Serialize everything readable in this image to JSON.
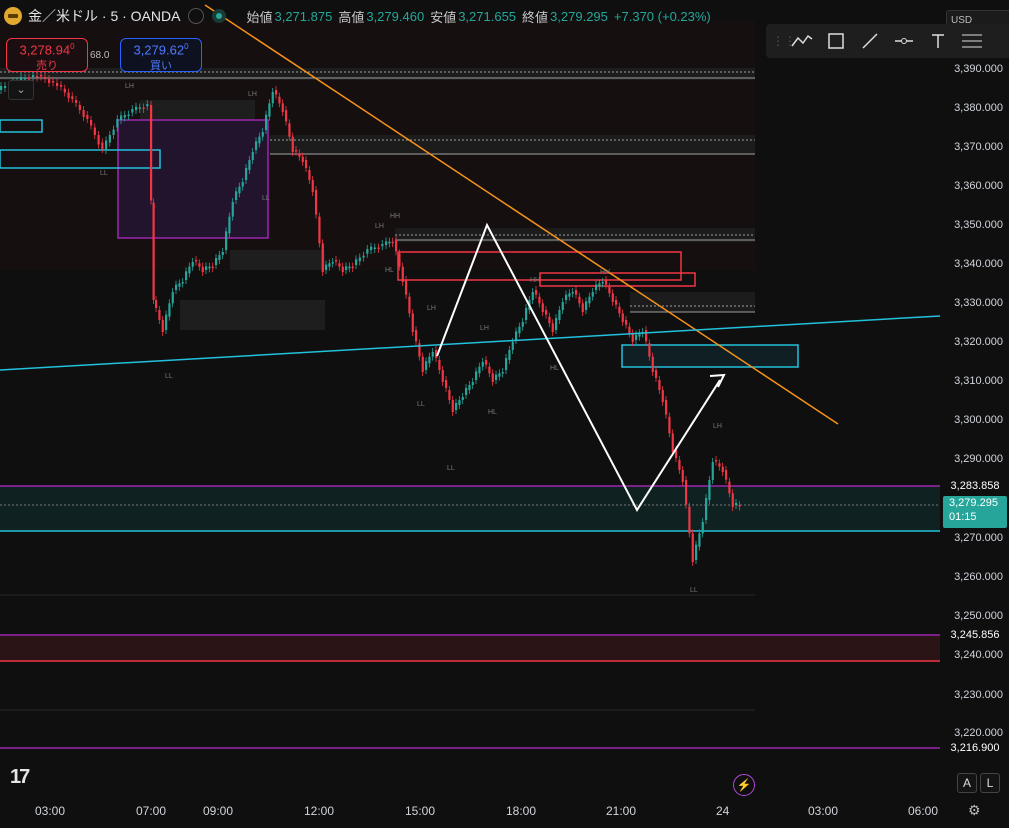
{
  "header": {
    "symbol": "金／米ドル · 5 · OANDA",
    "open_label": "始値",
    "open": "3,271.875",
    "high_label": "高値",
    "high": "3,279.460",
    "low_label": "安値",
    "low": "3,271.655",
    "close_label": "終値",
    "close": "3,279.295",
    "change": "+7.370 (+0.23%)"
  },
  "trade": {
    "sell_price": "3,278.94",
    "sell_price_sup": "0",
    "sell_label": "売り",
    "spread": "68.0",
    "buy_price": "3,279.62",
    "buy_price_sup": "0",
    "buy_label": "買い"
  },
  "toolbar": {
    "icons": [
      "pattern-icon",
      "rectangle-icon",
      "trendline-icon",
      "horizontal-ray-icon",
      "text-icon",
      "fib-icon"
    ]
  },
  "currency": "USD",
  "y_axis": {
    "labels": [
      "3,390.000",
      "3,380.000",
      "3,370.000",
      "3,360.000",
      "3,350.000",
      "3,340.000",
      "3,330.000",
      "3,320.000",
      "3,310.000",
      "3,300.000",
      "3,290.000",
      "3,270.000",
      "3,260.000",
      "3,250.000",
      "3,240.000",
      "3,230.000",
      "3,220.000"
    ],
    "tags": [
      {
        "value": "3,283.858",
        "color": "#9c27b0"
      },
      {
        "value": "3,245.856",
        "color": "#9c27b0"
      },
      {
        "value": "3,216.900",
        "color": "#9c27b0"
      }
    ],
    "current_price": "3,279.295",
    "countdown": "01:15"
  },
  "x_axis": {
    "labels": [
      "03:00",
      "07:00",
      "09:00",
      "12:00",
      "15:00",
      "18:00",
      "21:00",
      "24",
      "03:00",
      "06:00"
    ]
  },
  "buttons": {
    "auto": "A",
    "log": "L"
  },
  "colors": {
    "up": "#26a69a",
    "down": "#f23645",
    "trendline": "#f7931a",
    "channel": "#22c1dc",
    "zone_purple": "#9c27b0"
  }
}
